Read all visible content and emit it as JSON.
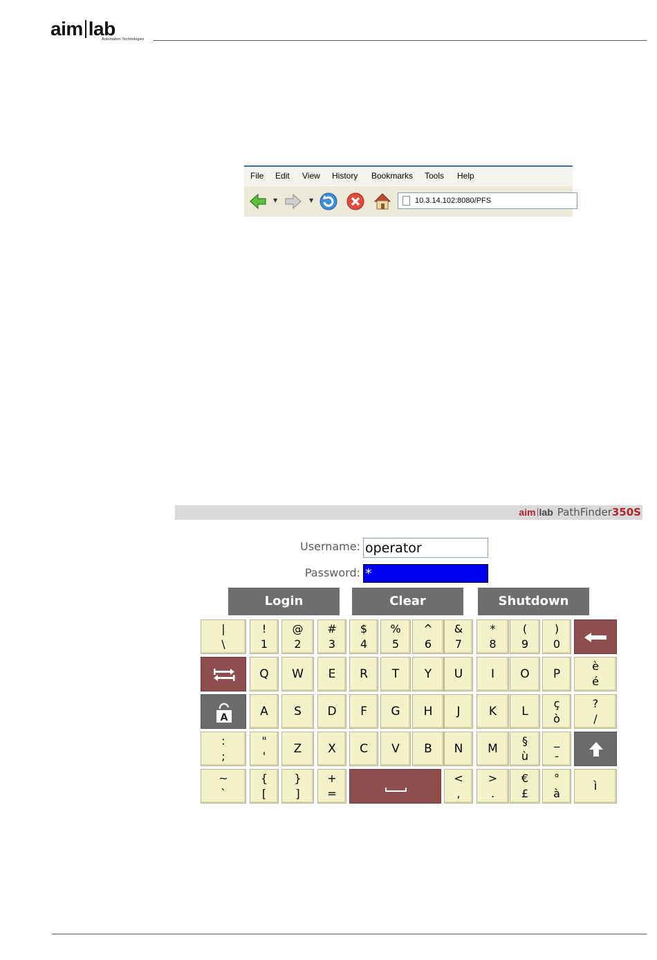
{
  "document": {
    "logo_word_left": "aim",
    "logo_word_right": "lab",
    "logo_tagline": "Automation Technologies"
  },
  "browser": {
    "menu": [
      "File",
      "Edit",
      "View",
      "History",
      "Bookmarks",
      "Tools",
      "Help"
    ],
    "address": "10.3.14.102:8080/PFS"
  },
  "app": {
    "brand_aim": "aim",
    "brand_lab": "lab",
    "product_name": "PathFinder",
    "product_model": "350S",
    "username_label": "Username:",
    "username_value": "operator",
    "password_label": "Password:",
    "password_value": "*",
    "buttons": {
      "login": "Login",
      "clear": "Clear",
      "shutdown": "Shutdown"
    }
  },
  "keyboard": {
    "rows": [
      [
        {
          "top": "|",
          "bot": "\\"
        },
        {
          "top": "!",
          "bot": "1"
        },
        {
          "top": "@",
          "bot": "2"
        },
        {
          "top": "#",
          "bot": "3"
        },
        {
          "top": "$",
          "bot": "4"
        },
        {
          "top": "%",
          "bot": "5"
        },
        {
          "top": "^",
          "bot": "6"
        },
        {
          "top": "&",
          "bot": "7"
        },
        {
          "top": "*",
          "bot": "8"
        },
        {
          "top": "(",
          "bot": "9"
        },
        {
          "top": ")",
          "bot": "0"
        },
        {
          "icon": "backspace-arrow-icon",
          "style": "red"
        }
      ],
      [
        {
          "icon": "tab-arrows-icon",
          "style": "red"
        },
        {
          "label": "Q"
        },
        {
          "label": "W"
        },
        {
          "label": "E"
        },
        {
          "label": "R"
        },
        {
          "label": "T"
        },
        {
          "label": "Y"
        },
        {
          "label": "U"
        },
        {
          "label": "I"
        },
        {
          "label": "O"
        },
        {
          "label": "P"
        },
        {
          "top": "è",
          "bot": "é"
        }
      ],
      [
        {
          "icon": "caps-lock-icon",
          "style": "grey",
          "label": "A"
        },
        {
          "label": "A"
        },
        {
          "label": "S"
        },
        {
          "label": "D"
        },
        {
          "label": "F"
        },
        {
          "label": "G"
        },
        {
          "label": "H"
        },
        {
          "label": "J"
        },
        {
          "label": "K"
        },
        {
          "label": "L"
        },
        {
          "top": "ç",
          "bot": "ò"
        },
        {
          "top": "?",
          "bot": "/"
        }
      ],
      [
        {
          "top": ":",
          "bot": ";"
        },
        {
          "top": "\"",
          "bot": "'"
        },
        {
          "label": "Z"
        },
        {
          "label": "X"
        },
        {
          "label": "C"
        },
        {
          "label": "V"
        },
        {
          "label": "B"
        },
        {
          "label": "N"
        },
        {
          "label": "M"
        },
        {
          "top": "§",
          "bot": "ù"
        },
        {
          "top": "_",
          "bot": "-"
        },
        {
          "icon": "shift-arrow-icon",
          "style": "grey"
        }
      ],
      [
        {
          "top": "~",
          "bot": "`"
        },
        {
          "top": "{",
          "bot": "["
        },
        {
          "top": "}",
          "bot": "]"
        },
        {
          "top": "+",
          "bot": "="
        },
        {
          "icon": "space-bar-icon",
          "style": "red"
        },
        {
          "top": "<",
          "bot": ","
        },
        {
          "top": ">",
          "bot": "."
        },
        {
          "top": "€",
          "bot": "£"
        },
        {
          "top": "°",
          "bot": "à"
        },
        {
          "label": "ì"
        }
      ]
    ]
  }
}
